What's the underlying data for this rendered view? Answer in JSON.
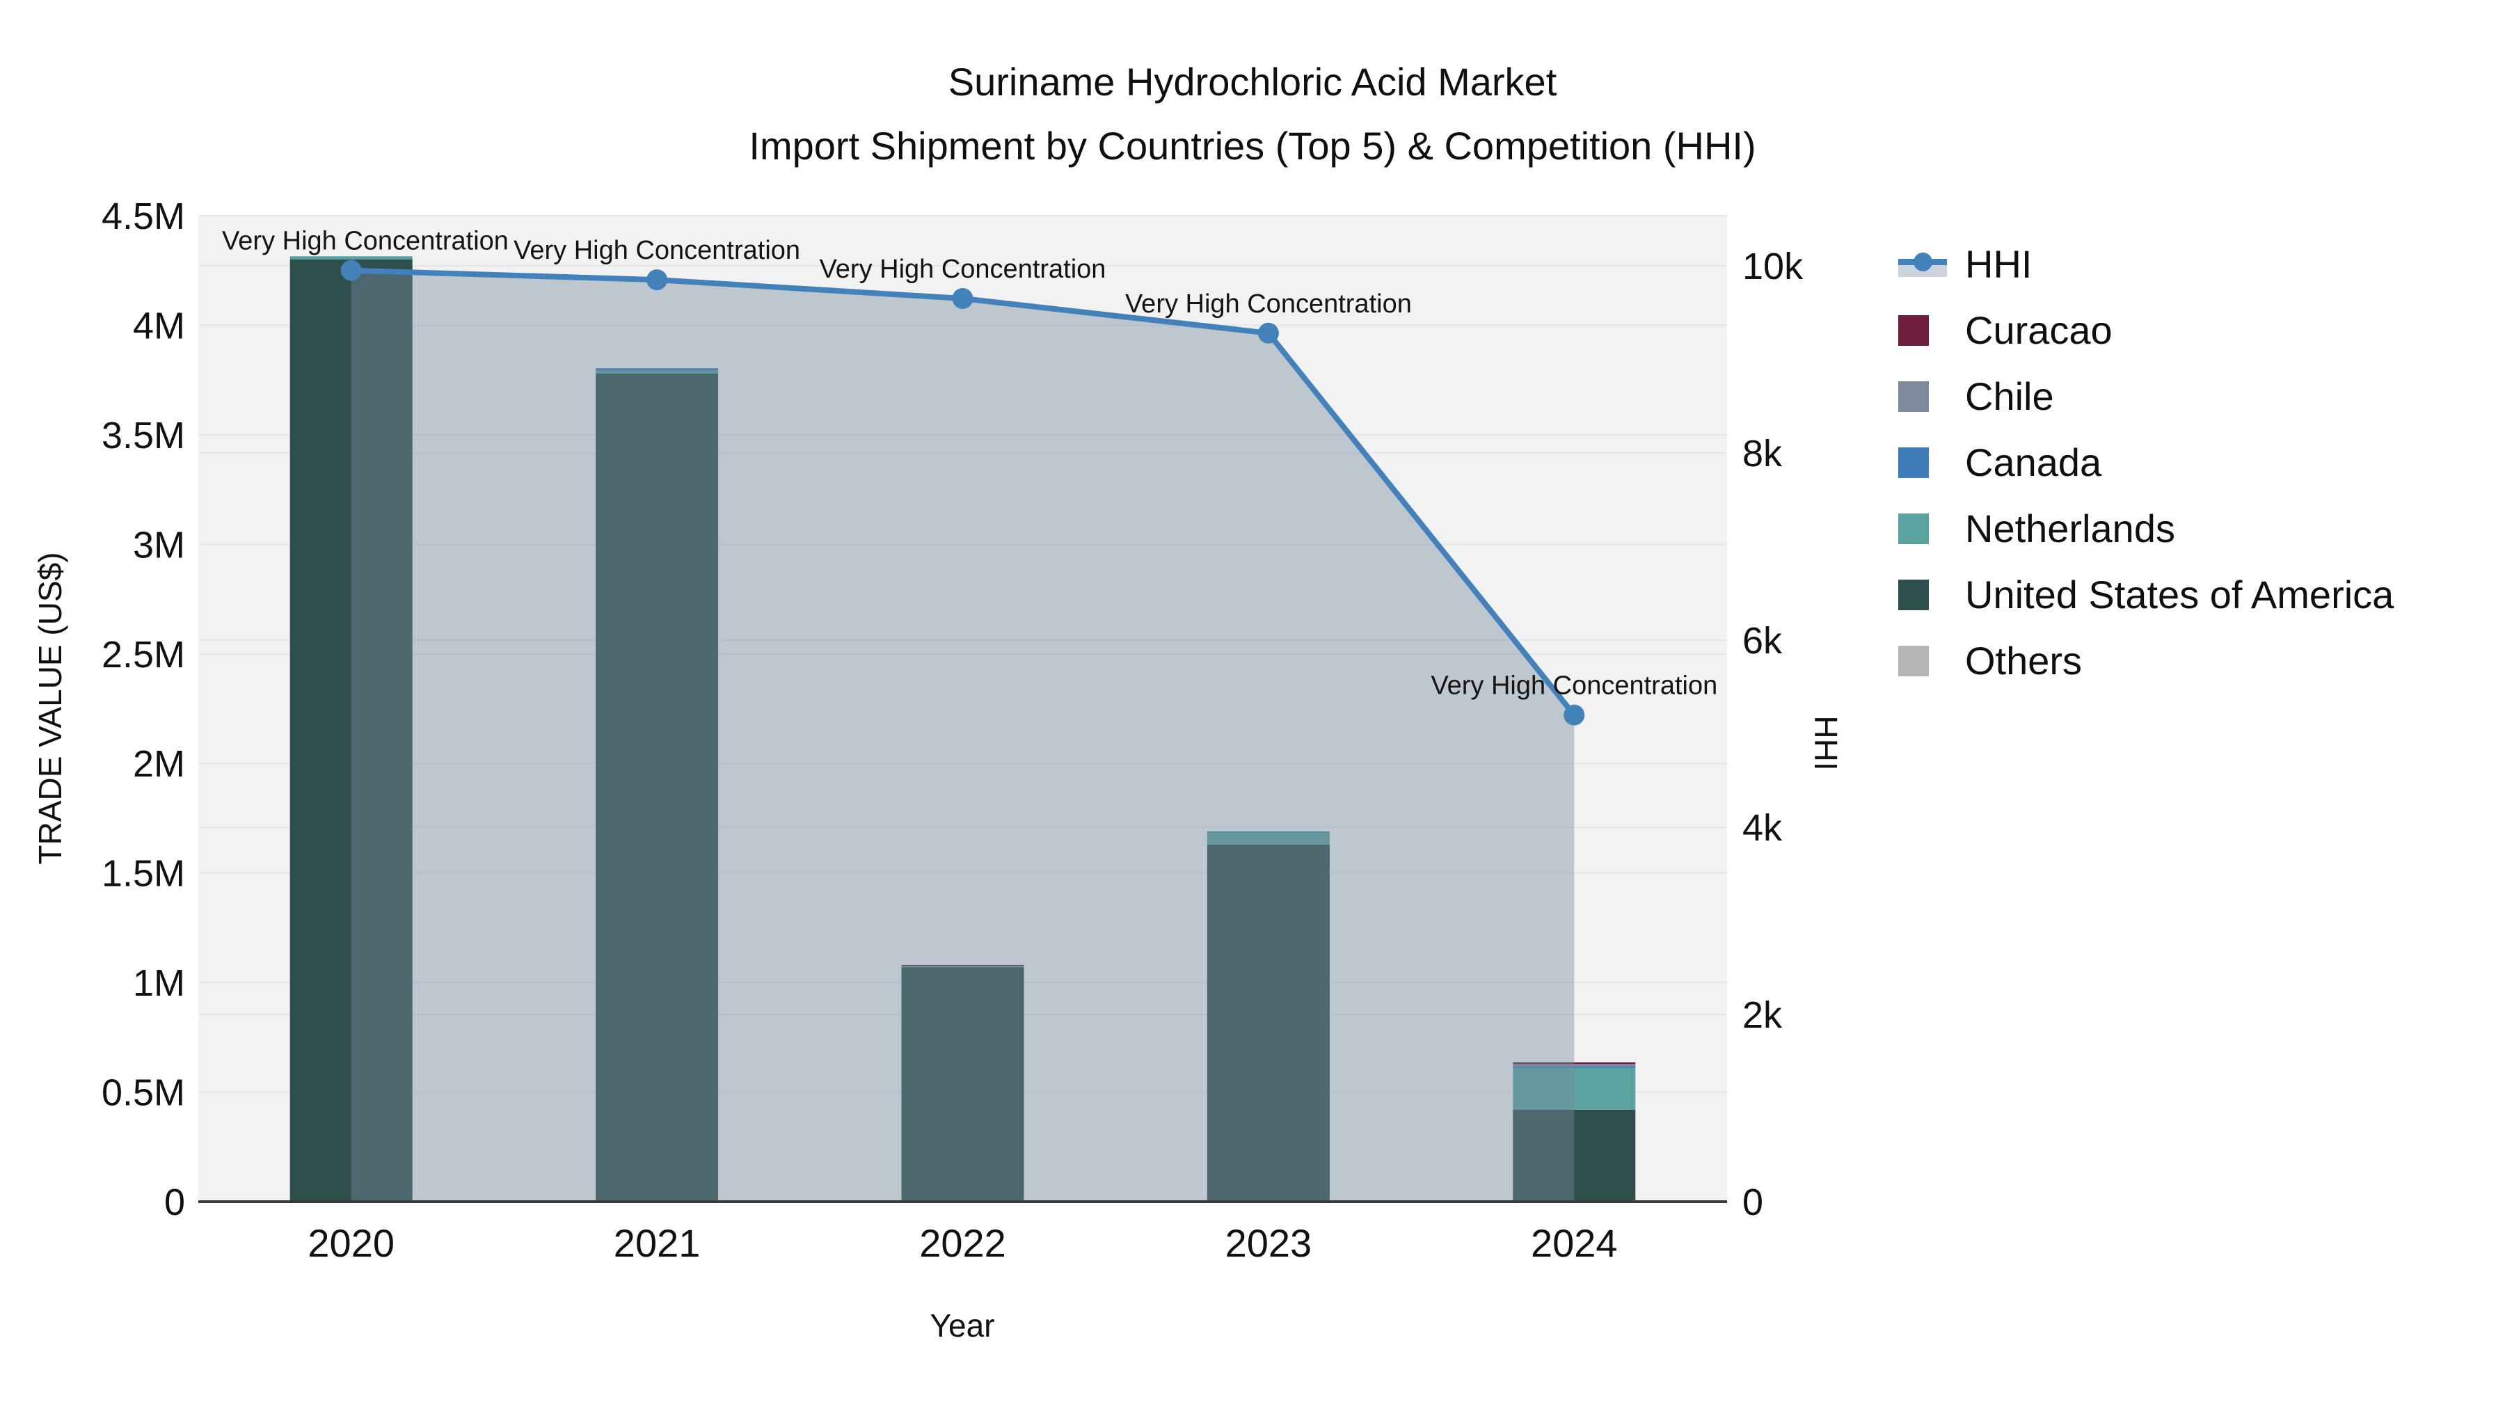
{
  "title": {
    "line1": "Suriname Hydrochloric Acid Market",
    "line2": "Import Shipment by Countries (Top 5) & Competition (HHI)"
  },
  "chart_data": {
    "type": "bar+line",
    "x_axis": {
      "title": "Year",
      "labels": [
        "2020",
        "2021",
        "2022",
        "2023",
        "2024"
      ]
    },
    "y_left": {
      "title": "TRADE VALUE (US$)",
      "tick_labels": [
        "0",
        "0.5M",
        "1M",
        "1.5M",
        "2M",
        "2.5M",
        "3M",
        "3.5M",
        "4M",
        "4.5M"
      ],
      "tick_values": [
        0,
        500000,
        1000000,
        1500000,
        2000000,
        2500000,
        3000000,
        3500000,
        4000000,
        4500000
      ],
      "ylim": [
        0,
        4500000
      ]
    },
    "y_right": {
      "title": "HHI",
      "tick_labels": [
        "0",
        "2k",
        "4k",
        "6k",
        "8k",
        "10k"
      ],
      "tick_values": [
        0,
        2000,
        4000,
        6000,
        8000,
        10000
      ],
      "ylim": [
        0,
        10535
      ]
    },
    "bar_series": [
      {
        "name": "Curacao",
        "color": "#701d3e",
        "values": [
          0,
          0,
          4000,
          0,
          8000
        ]
      },
      {
        "name": "Chile",
        "color": "#7d8a9c",
        "values": [
          0,
          0,
          0,
          0,
          10000
        ]
      },
      {
        "name": "Canada",
        "color": "#3e7cba",
        "values": [
          0,
          12000,
          0,
          5000,
          8000
        ]
      },
      {
        "name": "Netherlands",
        "color": "#5ba3a1",
        "values": [
          15000,
          12000,
          6000,
          55000,
          190000
        ]
      },
      {
        "name": "United States of America",
        "color": "#2f4f4c",
        "values": [
          4300000,
          3780000,
          1070000,
          1630000,
          420000
        ]
      },
      {
        "name": "Others",
        "color": "#b3b5b6",
        "values": [
          0,
          0,
          0,
          0,
          0
        ]
      }
    ],
    "stack_order_bottom_to_top": [
      "United States of America",
      "Netherlands",
      "Canada",
      "Chile",
      "Curacao",
      "Others"
    ],
    "line_series": {
      "name": "HHI",
      "color": "#4281ba",
      "area_color": "rgba(119,138,157,0.42)",
      "values": [
        9950,
        9850,
        9650,
        9280,
        5200
      ]
    },
    "annotations": [
      "Very High Concentration",
      "Very High Concentration",
      "Very High Concentration",
      "Very High Concentration",
      "Very High Concentration"
    ],
    "grid": true,
    "legend_position": "right"
  },
  "legend": {
    "items": [
      {
        "label": "HHI",
        "type": "line",
        "color": "#4281ba",
        "band": "#ccd3dc"
      },
      {
        "label": "Curacao",
        "type": "square",
        "color": "#701d3e"
      },
      {
        "label": "Chile",
        "type": "square",
        "color": "#7d8a9c"
      },
      {
        "label": "Canada",
        "type": "square",
        "color": "#3e7cba"
      },
      {
        "label": "Netherlands",
        "type": "square",
        "color": "#5ba3a1"
      },
      {
        "label": "United States of America",
        "type": "square",
        "color": "#2f4f4c"
      },
      {
        "label": "Others",
        "type": "square",
        "color": "#b3b5b6"
      }
    ]
  },
  "style": {
    "plot_bg": "#f2f2f2",
    "grid_color": "#e4e6e8",
    "axis_line_color": "#3d3d3d",
    "text_color": "#111111"
  }
}
